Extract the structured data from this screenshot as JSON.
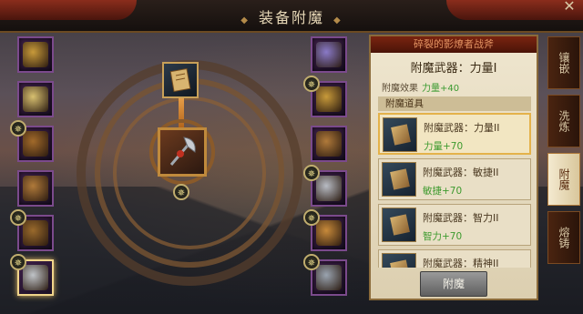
{
  "window": {
    "title": "装备附魔",
    "close_symbol": "✕"
  },
  "left_slots": [
    {
      "name": "helmet-slot",
      "color": "#c89a3a",
      "star": false,
      "selected": false
    },
    {
      "name": "necklace-slot",
      "color": "#d8c070",
      "star": false,
      "selected": false
    },
    {
      "name": "armor-slot",
      "color": "#a26a2a",
      "star": true,
      "selected": false
    },
    {
      "name": "bracer-slot",
      "color": "#b07a3a",
      "star": false,
      "selected": false
    },
    {
      "name": "ring-slot-left",
      "color": "#9a6a2c",
      "star": true,
      "selected": false
    },
    {
      "name": "weapon-slot",
      "color": "#c0c4c8",
      "star": true,
      "selected": true
    }
  ],
  "right_slots": [
    {
      "name": "amulet-slot",
      "color": "#8a7ac8",
      "star": false
    },
    {
      "name": "shoulder-slot",
      "color": "#c89a3a",
      "star": true
    },
    {
      "name": "boots-slot",
      "color": "#b07a3a",
      "star": false
    },
    {
      "name": "talisman-slot",
      "color": "#b8bcc4",
      "star": true
    },
    {
      "name": "ring-slot-right",
      "color": "#c88a3a",
      "star": true
    },
    {
      "name": "offhand-slot",
      "color": "#9aa4b0",
      "star": true
    }
  ],
  "star_symbol": "✵",
  "panel": {
    "header": "碎裂的影燎者战斧",
    "enchant_weapon": "附魔武器：力量I",
    "effect_label": "附魔效果",
    "effect_value": "力量+40",
    "items_label": "附魔道具",
    "items": [
      {
        "name": "附魔武器：力量II",
        "bonus": "力量+70",
        "selected": true
      },
      {
        "name": "附魔武器：敏捷II",
        "bonus": "敏捷+70",
        "selected": false
      },
      {
        "name": "附魔武器：智力II",
        "bonus": "智力+70",
        "selected": false
      },
      {
        "name": "附魔武器：精神II",
        "bonus": "",
        "selected": false
      }
    ],
    "button_label": "附魔"
  },
  "tabs": [
    {
      "label": "镶嵌",
      "active": false
    },
    {
      "label": "洗炼",
      "active": false
    },
    {
      "label": "附魔",
      "active": true
    },
    {
      "label": "熔铸",
      "active": false
    }
  ]
}
